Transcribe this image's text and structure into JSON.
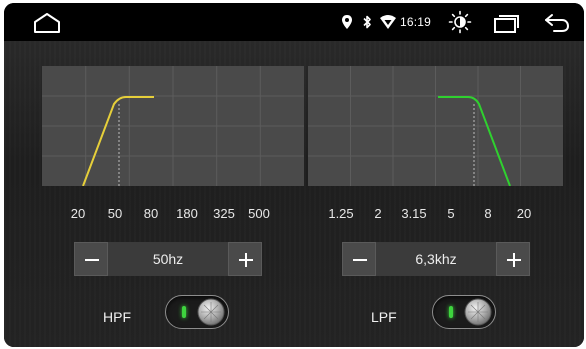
{
  "status_bar": {
    "icons": [
      "home-icon",
      "location-icon",
      "bluetooth-icon",
      "wifi-icon",
      "brightness-icon",
      "recent-apps-icon",
      "back-icon"
    ],
    "time": "16:19"
  },
  "hpf": {
    "ticks": [
      "20",
      "50",
      "80",
      "180",
      "325",
      "500"
    ],
    "value": "50hz",
    "label": "HPF",
    "enabled": true,
    "curve_color": "#e6cf3a"
  },
  "lpf": {
    "ticks": [
      "1.25",
      "2",
      "3.15",
      "5",
      "8",
      "20"
    ],
    "value": "6,3khz",
    "label": "LPF",
    "enabled": true,
    "curve_color": "#2fd12f"
  },
  "colors": {
    "graph_bg": "#4a4a4a",
    "grid": "#5c5c5c",
    "toggle_led": "#3ed43e"
  }
}
